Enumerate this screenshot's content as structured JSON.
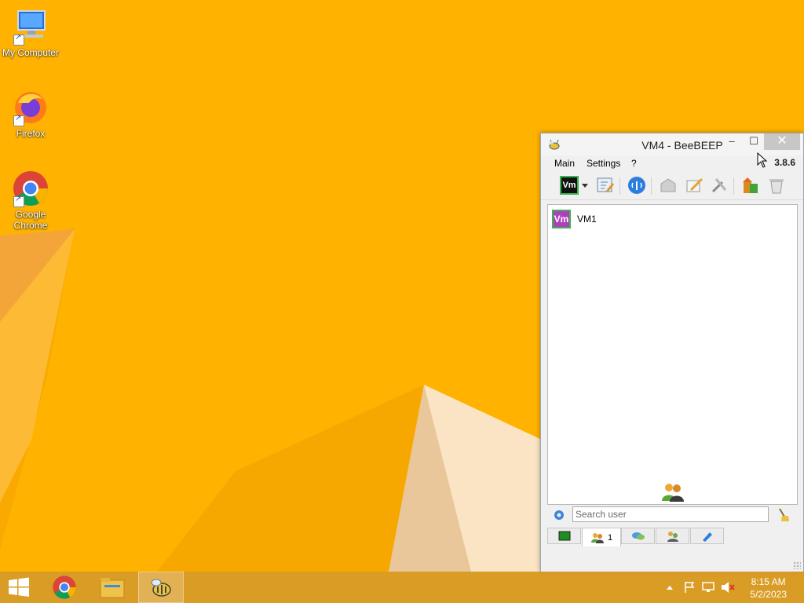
{
  "desktop": {
    "icons": [
      {
        "label": "My Computer"
      },
      {
        "label": "Firefox"
      },
      {
        "label": "Google Chrome"
      }
    ]
  },
  "window": {
    "title": "VM4 - BeeBEEP",
    "minimize_glyph": "–",
    "maximize_glyph": "☐",
    "close_glyph": "✕",
    "menu": [
      "Main",
      "Settings",
      "?"
    ],
    "version": "3.8.6",
    "toolbar": {
      "profile_badge": "Vm",
      "icons": [
        "vm-profile-icon",
        "dropdown-arrow-icon",
        "edit-status-icon",
        "network-icon",
        "message-icon",
        "compose-icon",
        "tools-icon",
        "file-share-icon",
        "trash-icon"
      ]
    },
    "users": [
      {
        "avatar_text": "Vm",
        "name": "VM1"
      }
    ],
    "search": {
      "placeholder": "Search user"
    },
    "tabs": [
      {
        "icon": "chat-board-icon",
        "label": ""
      },
      {
        "icon": "users-icon",
        "label": "1"
      },
      {
        "icon": "chats-icon",
        "label": ""
      },
      {
        "icon": "groups-icon",
        "label": ""
      },
      {
        "icon": "file-transfer-icon",
        "label": ""
      }
    ],
    "colors": {
      "avatar_bg": "#b03fbf",
      "avatar_border": "#3bb34a",
      "close_button": "#c7c7c7"
    }
  },
  "taskbar": {
    "apps": [
      "start-icon",
      "chrome-icon",
      "file-explorer-icon",
      "beebeep-icon"
    ],
    "clock": {
      "time": "8:15 AM",
      "date": "5/2/2023"
    }
  }
}
